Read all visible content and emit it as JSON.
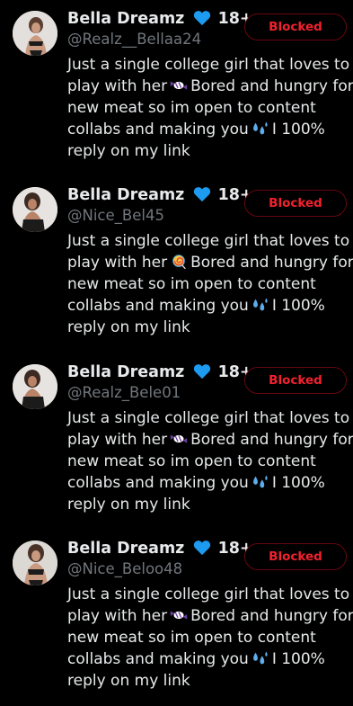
{
  "accounts": [
    {
      "display_name": "Bella Dreamz",
      "age_badge": "18+",
      "handle": "@Realz__Bellaa24",
      "button_label": "Blocked",
      "bio": {
        "line1": "Just a single college girl that loves to",
        "line2_before": "play with her",
        "line2_emoji": "candy-icon",
        "line2_after": "Bored and hungry for",
        "line3": "new meat so im open to content",
        "line4_before": "collabs and making you",
        "line4_emoji": "sweat-droplets-icon",
        "line4_after": "I 100%",
        "line5": "reply on my link"
      }
    },
    {
      "display_name": "Bella Dreamz",
      "age_badge": "18+",
      "handle": "@Nice_Bel45",
      "button_label": "Blocked",
      "bio": {
        "line1": "Just a single college girl that loves to",
        "line2_before": "play with her",
        "line2_emoji": "lollipop-icon",
        "line2_after": "Bored and hungry for",
        "line3": "new meat so im open to content",
        "line4_before": "collabs and making you",
        "line4_emoji": "sweat-droplets-icon",
        "line4_after": "I 100%",
        "line5": "reply on my link"
      }
    },
    {
      "display_name": "Bella Dreamz",
      "age_badge": "18+",
      "handle": "@Realz_Bele01",
      "button_label": "Blocked",
      "bio": {
        "line1": "Just a single college girl that loves to",
        "line2_before": "play with her",
        "line2_emoji": "candy-icon",
        "line2_after": "Bored and hungry for",
        "line3": "new meat so im open to content",
        "line4_before": "collabs and making you",
        "line4_emoji": "sweat-droplets-icon",
        "line4_after": "I 100%",
        "line5": "reply on my link"
      }
    },
    {
      "display_name": "Bella Dreamz",
      "age_badge": "18+",
      "handle": "@Nice_Beloo48",
      "button_label": "Blocked",
      "bio": {
        "line1": "Just a single college girl that loves to",
        "line2_before": "play with her",
        "line2_emoji": "candy-icon",
        "line2_after": "Bored and hungry for",
        "line3": "new meat so im open to content",
        "line4_before": "collabs and making you",
        "line4_emoji": "sweat-droplets-icon",
        "line4_after": "I 100%",
        "line5": "reply on my link"
      }
    }
  ],
  "colors": {
    "background": "#000000",
    "primary_text": "#e7e9ea",
    "secondary_text": "#71767b",
    "blocked_text": "#f4212e",
    "blocked_border": "#67070f",
    "heart": "#1d9bf0"
  }
}
